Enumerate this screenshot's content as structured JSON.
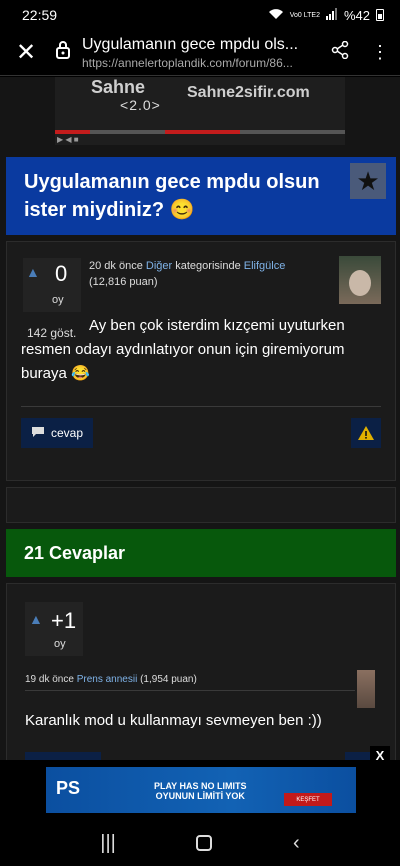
{
  "status": {
    "time": "22:59",
    "battery": "%42",
    "network": "Vo0 LTE2"
  },
  "browser": {
    "title": "Uygulamanın gece mpdu ols...",
    "url": "https://annelertoplandik.com/forum/86..."
  },
  "ad_top": {
    "logo_left": "Sahne",
    "logo_sub": "2.0",
    "logo_right": "Sahne2sifir.com"
  },
  "question": {
    "title": "Uygulamanın gece mpdu olsun ister miydiniz? 😊",
    "votes": "0",
    "votes_label": "oy",
    "views": "142 göst.",
    "meta_time": "20 dk önce",
    "category": "Diğer",
    "meta_mid": "kategorisinde",
    "author": "Elifgülce",
    "points": "(12,816 puan)",
    "body": "Ay ben çok isterdim kızçemi uyuturken resmen odayı aydınlatıyor onun için giremiyorum buraya 😂",
    "reply_label": "cevap"
  },
  "answers": {
    "heading": "21 Cevaplar",
    "items": [
      {
        "votes": "+1",
        "votes_label": "oy",
        "time": "19 dk önce",
        "author": "Prens annesii",
        "points": "(1,954 puan)",
        "body": "Karanlık mod u kullanmayı sevmeyen ben :))"
      }
    ]
  },
  "ad_bottom": {
    "brand": "PS",
    "line1": "PLAY HAS NO LIMITS",
    "line2": "OYUNUN LİMİTİ YOK",
    "cta": "KEŞFET",
    "close": "X"
  }
}
